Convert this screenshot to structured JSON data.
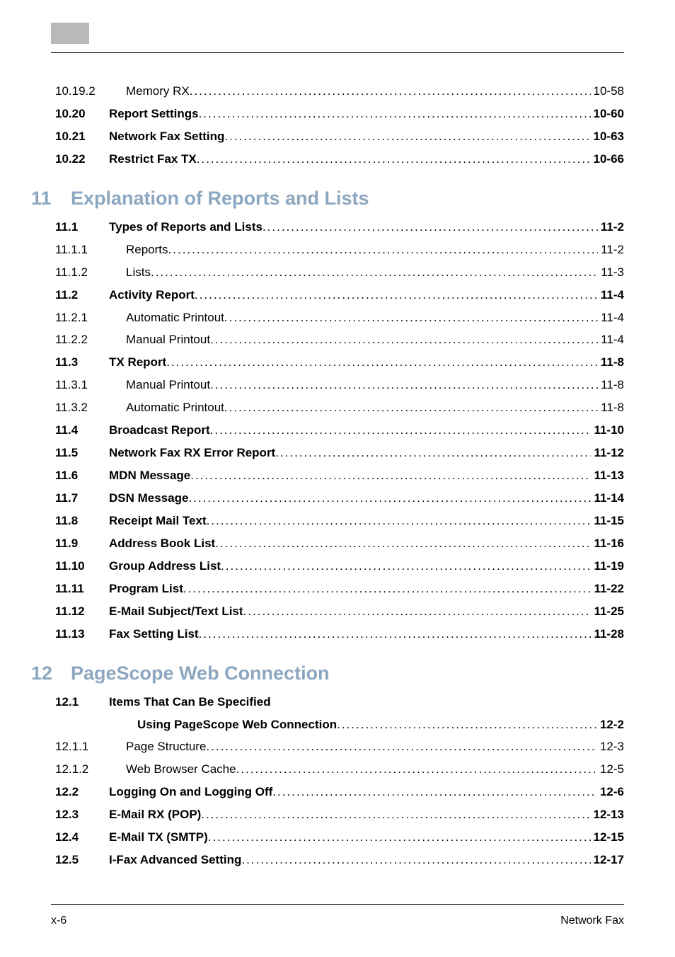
{
  "footer": {
    "left": "x-6",
    "right": "Network Fax"
  },
  "chapters": [
    {
      "num": "11",
      "title": "Explanation of Reports and Lists"
    },
    {
      "num": "12",
      "title": "PageScope Web Connection"
    }
  ],
  "lines": [
    {
      "num": "10.19.2",
      "title": "Memory RX",
      "page": "10-58",
      "bold": false,
      "indent": true
    },
    {
      "num": "10.20",
      "title": "Report Settings",
      "page": "10-60",
      "bold": true
    },
    {
      "num": "10.21",
      "title": "Network Fax Setting",
      "page": "10-63",
      "bold": true
    },
    {
      "num": "10.22",
      "title": "Restrict Fax TX",
      "page": "10-66",
      "bold": true
    },
    {
      "chapter": 0
    },
    {
      "num": "11.1",
      "title": "Types of Reports and Lists",
      "page": "11-2",
      "bold": true
    },
    {
      "num": "11.1.1",
      "title": "Reports",
      "page": "11-2",
      "bold": false,
      "indent": true
    },
    {
      "num": "11.1.2",
      "title": "Lists",
      "page": "11-3",
      "bold": false,
      "indent": true
    },
    {
      "num": "11.2",
      "title": "Activity Report",
      "page": "11-4",
      "bold": true
    },
    {
      "num": "11.2.1",
      "title": "Automatic Printout",
      "page": "11-4",
      "bold": false,
      "indent": true
    },
    {
      "num": "11.2.2",
      "title": "Manual Printout",
      "page": "11-4",
      "bold": false,
      "indent": true
    },
    {
      "num": "11.3",
      "title": "TX Report",
      "page": "11-8",
      "bold": true
    },
    {
      "num": "11.3.1",
      "title": "Manual Printout",
      "page": "11-8",
      "bold": false,
      "indent": true
    },
    {
      "num": "11.3.2",
      "title": "Automatic Printout",
      "page": "11-8",
      "bold": false,
      "indent": true
    },
    {
      "num": "11.4",
      "title": "Broadcast Report",
      "page": "11-10",
      "bold": true
    },
    {
      "num": "11.5",
      "title": "Network Fax RX Error Report",
      "page": "11-12",
      "bold": true
    },
    {
      "num": "11.6",
      "title": "MDN Message",
      "page": "11-13",
      "bold": true
    },
    {
      "num": "11.7",
      "title": "DSN Message",
      "page": "11-14",
      "bold": true
    },
    {
      "num": "11.8",
      "title": "Receipt Mail Text",
      "page": "11-15",
      "bold": true
    },
    {
      "num": "11.9",
      "title": "Address Book List",
      "page": "11-16",
      "bold": true
    },
    {
      "num": "11.10",
      "title": "Group Address List",
      "page": "11-19",
      "bold": true
    },
    {
      "num": "11.11",
      "title": "Program List",
      "page": "11-22",
      "bold": true
    },
    {
      "num": "11.12",
      "title": "E-Mail Subject/Text List",
      "page": "11-25",
      "bold": true
    },
    {
      "num": "11.13",
      "title": "Fax Setting List",
      "page": "11-28",
      "bold": true
    },
    {
      "chapter": 1
    },
    {
      "num": "12.1",
      "title": "Items That Can Be Specified",
      "bold": true,
      "nopage": true
    },
    {
      "num": "",
      "title": "Using PageScope Web Connection",
      "page": "12-2",
      "bold": true,
      "cont": true
    },
    {
      "num": "12.1.1",
      "title": "Page Structure",
      "page": "12-3",
      "bold": false,
      "indent": true
    },
    {
      "num": "12.1.2",
      "title": "Web Browser Cache",
      "page": "12-5",
      "bold": false,
      "indent": true
    },
    {
      "num": "12.2",
      "title": "Logging On and Logging Off",
      "page": "12-6",
      "bold": true
    },
    {
      "num": "12.3",
      "title": "E-Mail RX (POP)",
      "page": "12-13",
      "bold": true
    },
    {
      "num": "12.4",
      "title": "E-Mail TX (SMTP)",
      "page": "12-15",
      "bold": true
    },
    {
      "num": "12.5",
      "title": "I-Fax Advanced Setting",
      "page": "12-17",
      "bold": true
    }
  ]
}
